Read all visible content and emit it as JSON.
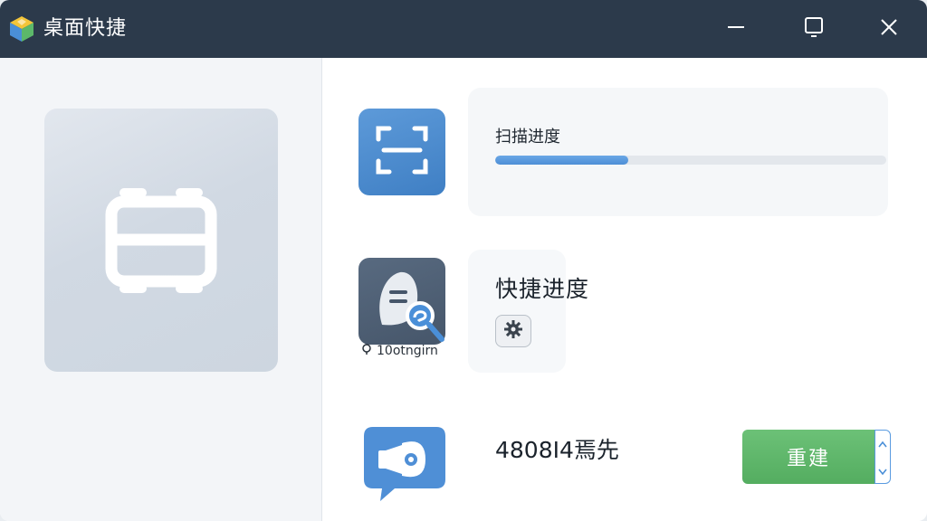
{
  "window": {
    "title": "桌面快捷",
    "controls": {
      "minimize_icon": "minimize-icon",
      "maximize_icon": "maximize-icon",
      "close_icon": "close-icon"
    }
  },
  "left_panel": {
    "preview_icon": "window-frame-icon"
  },
  "scan": {
    "icon": "scan-frame-icon",
    "label": "扫描进度",
    "progress": 0.34,
    "accent": "#4d8ed6"
  },
  "shortcut": {
    "icon": "search-document-icon",
    "label": "快捷进度",
    "caption": "10otngirn",
    "caption_icon": "pin-icon",
    "gear_icon": "gear-icon"
  },
  "summary": {
    "icon": "megaphone-gear-icon",
    "count_label": "4808I4焉先"
  },
  "actions": {
    "rebuild_label": "重建",
    "rebuild_color": "#5ab566",
    "dropdown_up_icon": "chevron-up-icon",
    "dropdown_down_icon": "chevron-down-icon"
  }
}
